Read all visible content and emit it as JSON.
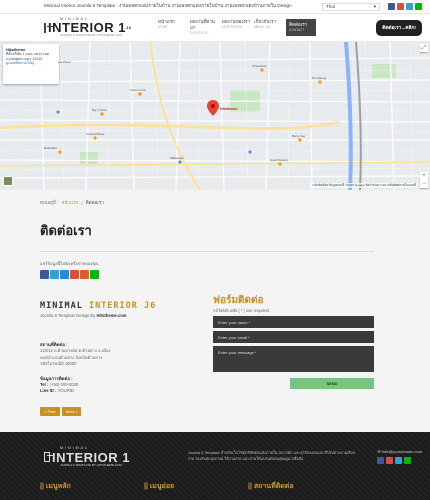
{
  "topbar": {
    "marquee": "Minimal Interior Joomla 6 Template : งานเพจตกแต่งภายในบ้าน งานเพจตกแต่งภายในบ้าน งานเพจตกแต่งบ้านภายใน Design",
    "language": "Thai",
    "social_colors": [
      "#3b5998",
      "#dd4b39",
      "#2ea3d6",
      "#00b900"
    ]
  },
  "header": {
    "logo_small": "MINIMAL",
    "logo_big": "INTERIOR",
    "logo_num": "1",
    "logo_sup": "J6",
    "logo_sub": "JOOMLA 6 TEMPLATE BY HITSTHEME.COM",
    "nav": [
      {
        "label": "หน้าแรก",
        "sub": "HOME"
      },
      {
        "label": "ผลงานที่ผ่านมา",
        "sub": "PORTFOLIO"
      },
      {
        "label": "ผลงานของเรา",
        "sub": "OUR WORKS"
      },
      {
        "label": "เกี่ยวกับเรา",
        "sub": "ABOUT US"
      },
      {
        "label": "ติดต่อเรา",
        "sub": "CONTACT"
      }
    ],
    "cta": "ติดต่อเรา...คลิก!"
  },
  "map": {
    "card_title": "Hitstheme",
    "card_address": "ที่ตั้งบริษัท 1 ถนน แขวง เขต กรุงเทพมหานคร 10110",
    "card_link": "ดูแผนที่ขนาดใหญ่",
    "pin_label": "Hitstheme",
    "footer_text": "แป้นพิมพ์ลัด  ข้อมูลแผนที่ ©2025 Google  ข้อกำหนด  รายงานข้อผิดพลาดในแผนที่",
    "places": [
      "Big C Extra",
      "Tesco Lotus",
      "Central Plaza",
      "Lat Phrao",
      "Chatuchak",
      "Bang Sue",
      "Huai Khwang",
      "Din Daeng",
      "Makkasan",
      "Ratchada"
    ]
  },
  "breadcrumb": {
    "prefix": "คุณอยู่ที่ :",
    "home": "หน้าแรก",
    "current": "ติดต่อเรา"
  },
  "page": {
    "title": "ติดต่อเรา",
    "share_label": "แชร์ข้อมูลนี้ไปยังเครือข่ายของคุณ",
    "share_colors": [
      "#3b5998",
      "#2ea3d6",
      "#1d8fd6",
      "#dd4b39",
      "#e05a2b",
      "#00b900"
    ]
  },
  "company": {
    "brand_a": "MINIMAL",
    "brand_b": "INTERIOR J6",
    "tagline": "Joomla 6 Template Design By",
    "tagline_site": "Hitstheme.com",
    "address_label": "สถานที่ติดต่อ :",
    "address_lines": [
      "123/12 ถ.ตัวอย่างต่อ ต.ตัวอย่าง อ.เมือง",
      "เขต/อำเภอตัวอย่าง จังหวัดตัวอย่าง",
      "รหัสไปรษณีย์ 10000"
    ],
    "contact_label": "ข้อมูลการติดต่อ :",
    "phone_label": "Tel :",
    "phone": "(+90) 000-0000",
    "line_label": "Line ID :",
    "line": "YOURID",
    "prev": "< Prev",
    "next": "Next >"
  },
  "form": {
    "title": "ฟอร์มติดต่อ",
    "required_note": "All fields with ( * ) are required",
    "name_placeholder": "Enter your name *",
    "email_placeholder": "Enter your email *",
    "message_placeholder": "Enter your message *",
    "send": "SEND"
  },
  "footer": {
    "text": "Joomla 6 Template สำหรับเว็บไซต์บริษัทตกแต่งภายใน สถาปนิก และธุรกิจออกแบบ ดีไซน์สวยงามเรียบง่าย รองรับทุกอุปกรณ์ ใช้งานง่าย และช่วยให้แบรนด์ของคุณดูน่าเชื่อถือ",
    "email": "info@yourdomain.com",
    "headings": [
      "|| เมนูหลัก",
      "|| เมนูย่อย",
      "|| สถานที่ติดต่อ"
    ]
  }
}
